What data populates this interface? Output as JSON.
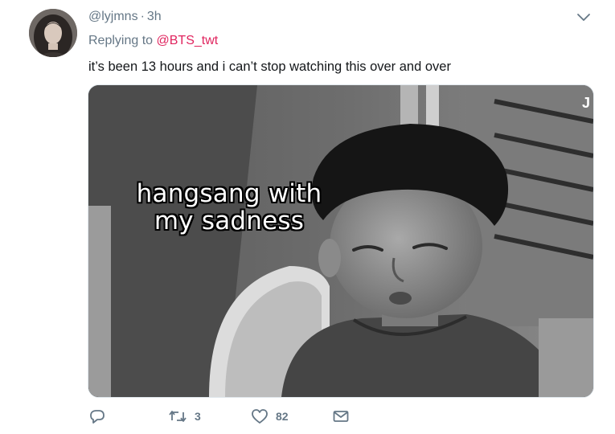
{
  "tweet": {
    "handle": "@lyjmns",
    "separator": "·",
    "timestamp": "3h",
    "reply_prefix": "Replying to ",
    "reply_mention": "@BTS_twt",
    "text": "it’s been 13 hours and i can’t stop watching this over and over",
    "media": {
      "caption_line1": "hangsang with",
      "caption_line2": "my sadness",
      "corner_mark": "J"
    }
  },
  "actions": {
    "reply_count": "",
    "retweet_count": "3",
    "like_count": "82"
  },
  "icons": {
    "menu": "chevron-down-icon",
    "reply": "reply-icon",
    "retweet": "retweet-icon",
    "like": "heart-icon",
    "dm": "envelope-icon"
  },
  "colors": {
    "mention": "#e0245e",
    "secondary_text": "#657786",
    "primary_text": "#14171a"
  }
}
